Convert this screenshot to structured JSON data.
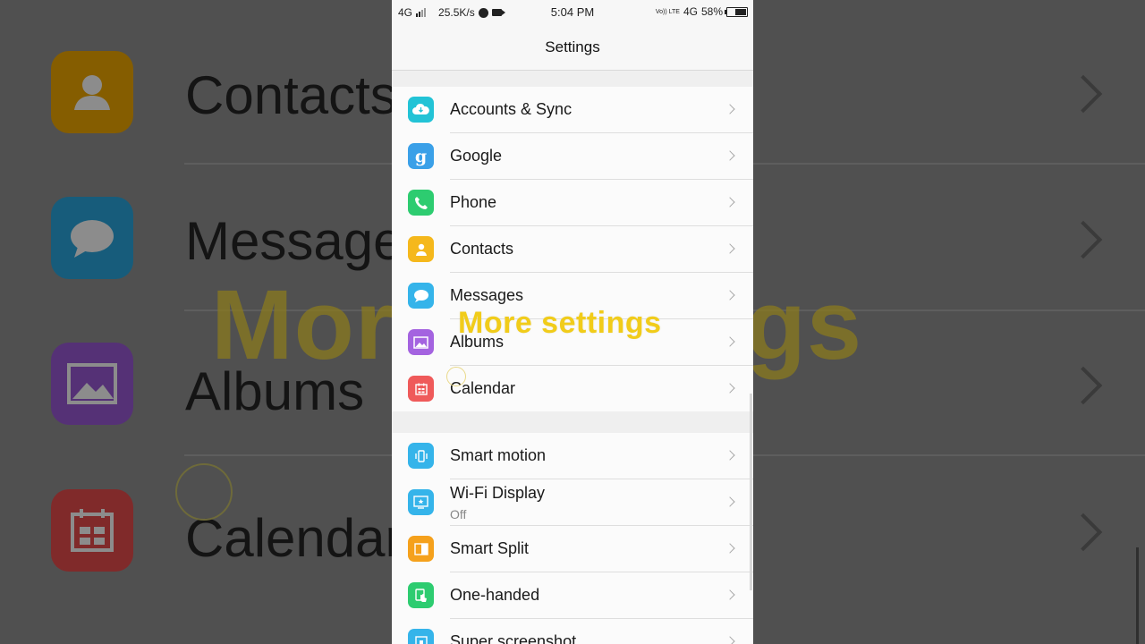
{
  "background": {
    "items": [
      {
        "label": "Contacts",
        "icon": "contacts-icon",
        "color": "#f2a900"
      },
      {
        "label": "Message",
        "icon": "messages-icon",
        "color": "#29a8e0"
      },
      {
        "label": "Albums",
        "icon": "albums-icon",
        "color": "#9b59d6"
      },
      {
        "label": "Calendar",
        "icon": "calendar-icon",
        "color": "#e84c4c"
      }
    ],
    "overlay_text": "More settings"
  },
  "status_bar": {
    "network": "4G",
    "speed": "25.5K/s",
    "time": "5:04 PM",
    "volte": "Vo)) LTE",
    "network_right": "4G",
    "battery": "58%"
  },
  "header": {
    "title": "Settings"
  },
  "group1": [
    {
      "label": "Accounts & Sync",
      "icon": "cloud-sync-icon",
      "color": "#22c3d6"
    },
    {
      "label": "Google",
      "icon": "google-icon",
      "color": "#3aa0e8"
    },
    {
      "label": "Phone",
      "icon": "phone-icon",
      "color": "#2dcc70"
    },
    {
      "label": "Contacts",
      "icon": "contacts-icon",
      "color": "#f5b81c"
    },
    {
      "label": "Messages",
      "icon": "messages-icon",
      "color": "#35b4ea"
    },
    {
      "label": "Albums",
      "icon": "albums-icon",
      "color": "#a463e0"
    },
    {
      "label": "Calendar",
      "icon": "calendar-icon",
      "color": "#ef5a5a"
    }
  ],
  "group2": [
    {
      "label": "Smart motion",
      "icon": "smart-motion-icon",
      "color": "#35b4ea"
    },
    {
      "label": "Wi-Fi Display",
      "sublabel": "Off",
      "icon": "wifi-display-icon",
      "color": "#35b4ea"
    },
    {
      "label": "Smart Split",
      "icon": "smart-split-icon",
      "color": "#f5a11c"
    },
    {
      "label": "One-handed",
      "icon": "one-handed-icon",
      "color": "#2dcc70"
    },
    {
      "label": "Super screenshot",
      "icon": "screenshot-icon",
      "color": "#35b4ea"
    }
  ],
  "overlay": {
    "text": "More settings"
  }
}
